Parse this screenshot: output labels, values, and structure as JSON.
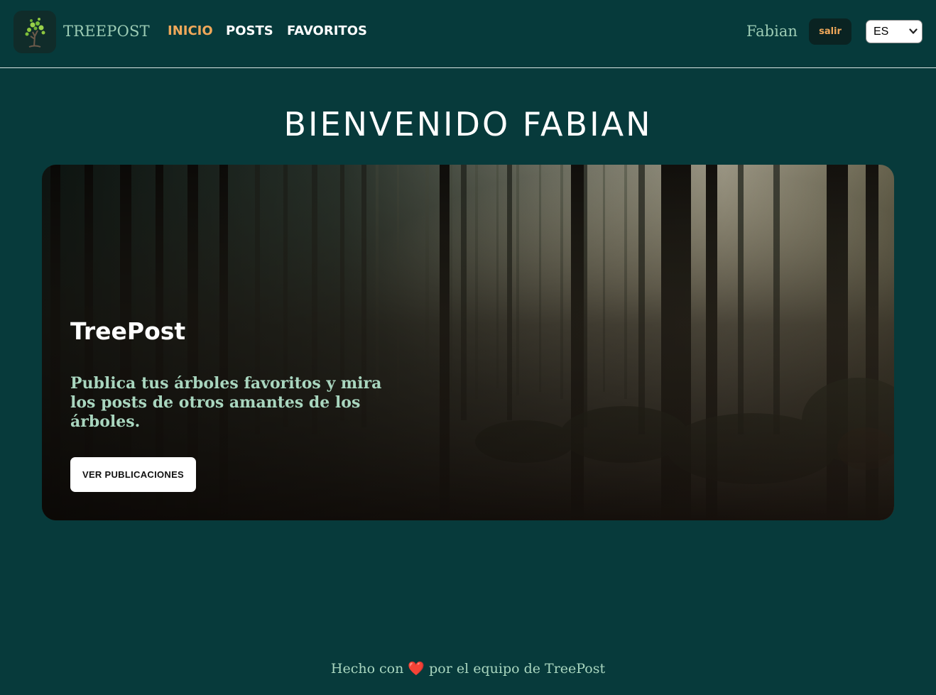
{
  "navbar": {
    "brand": "TREEPOST",
    "logo_icon": "tree-icon",
    "links": [
      {
        "label": "INICIO",
        "active": true
      },
      {
        "label": "POSTS",
        "active": false
      },
      {
        "label": "FAVORITOS",
        "active": false
      }
    ],
    "user_name": "Fabian",
    "logout_label": "salir",
    "language": {
      "selected": "ES"
    }
  },
  "main": {
    "welcome": "BIENVENIDO FABIAN",
    "hero": {
      "title": "TreePost",
      "subtitle": "Publica tus árboles favoritos y mira los posts de otros amantes de los árboles.",
      "button_label": "VER PUBLICACIONES",
      "background_icon": "forest-image"
    }
  },
  "footer": {
    "text_before": "Hecho con",
    "heart_icon": "heart-icon",
    "heart": "❤️",
    "text_after": "por el equipo de TreePost"
  },
  "colors": {
    "background": "#073a3b",
    "accent": "#f0a85a",
    "muted_green": "#9ccbb4"
  }
}
